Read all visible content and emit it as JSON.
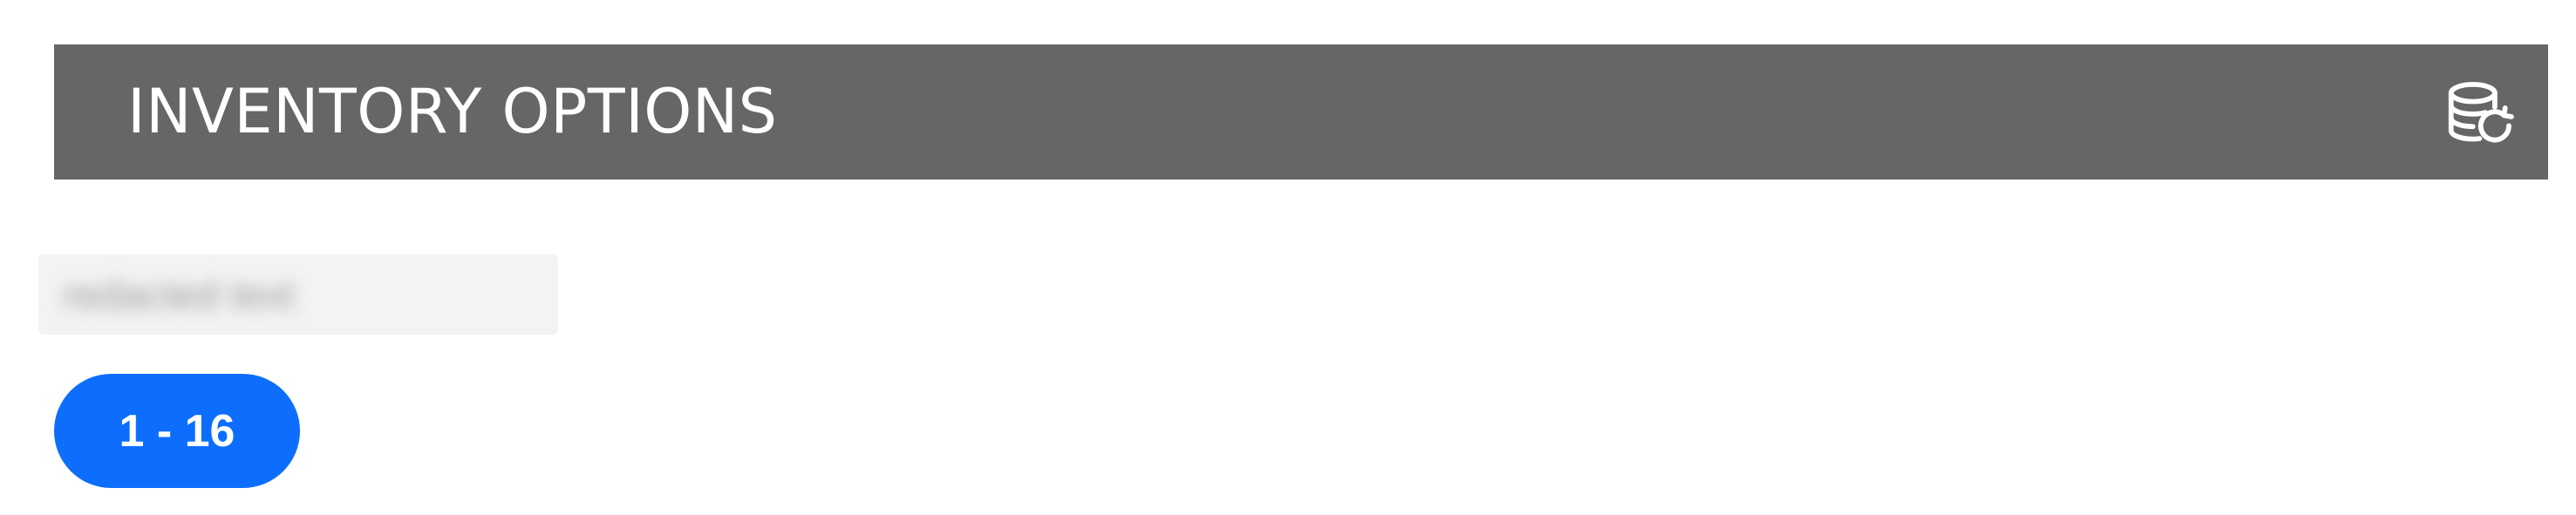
{
  "header": {
    "title": "INVENTORY OPTIONS",
    "action_icon": "database-refresh-icon",
    "background_color": "#666666"
  },
  "blurred_text": {
    "value": "redacted text"
  },
  "range_badge": {
    "label": "1 - 16",
    "color": "#0d6efd"
  }
}
